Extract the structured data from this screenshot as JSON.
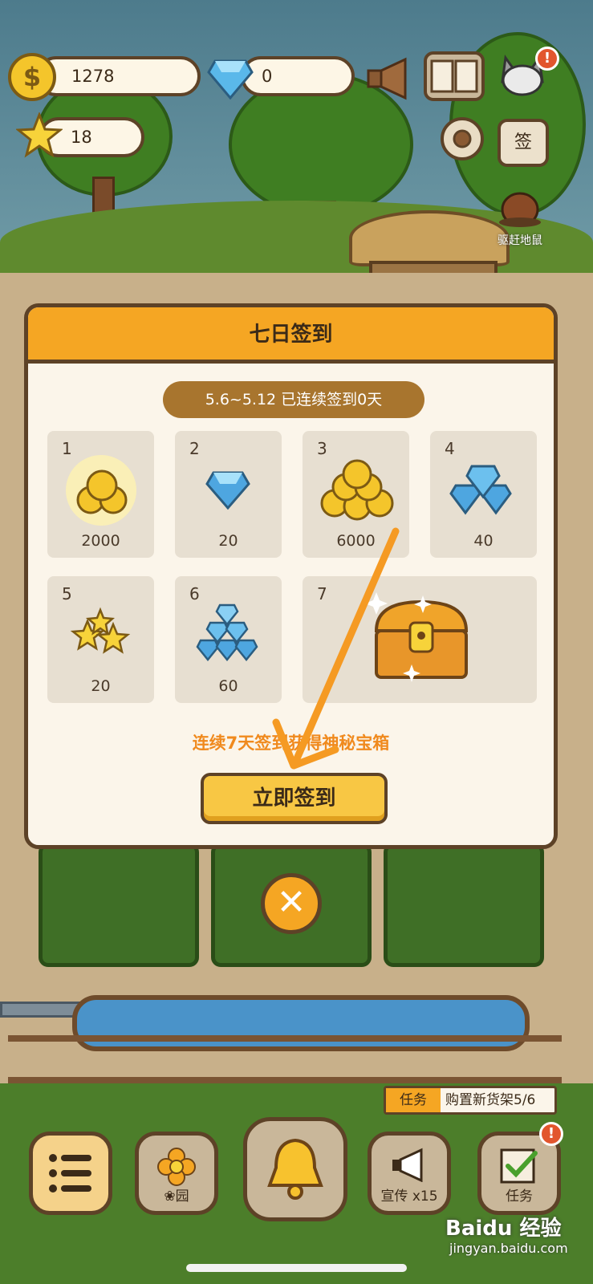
{
  "hud": {
    "coins": "1278",
    "gems": "0",
    "stars": "18",
    "coin_symbol": "$",
    "signin_badge": "签",
    "mole_label": "驱赶地鼠",
    "alert": "!"
  },
  "modal": {
    "title": "七日签到",
    "date_range": "5.6~5.12 已连续签到0天",
    "days": [
      {
        "num": "1",
        "value": "2000",
        "reward": "coin-icon"
      },
      {
        "num": "2",
        "value": "20",
        "reward": "gem-icon"
      },
      {
        "num": "3",
        "value": "6000",
        "reward": "coin-pile-icon"
      },
      {
        "num": "4",
        "value": "40",
        "reward": "gem-pile-icon"
      },
      {
        "num": "5",
        "value": "20",
        "reward": "star-icon"
      },
      {
        "num": "6",
        "value": "60",
        "reward": "gem-heap-icon"
      },
      {
        "num": "7",
        "value": "",
        "reward": "treasure-chest-icon"
      }
    ],
    "footer": "连续7天签到获得神秘宝箱",
    "signin_button": "立即签到",
    "close": "✕"
  },
  "bottom": {
    "task_tag": "任务",
    "task_text": "购置新货架5/6",
    "nav": [
      {
        "label": "",
        "icon": "list-icon"
      },
      {
        "label": "❀园",
        "icon": "flower-icon"
      },
      {
        "label": "",
        "icon": "bell-icon"
      },
      {
        "label": "宣传 x15",
        "icon": "megaphone-icon"
      },
      {
        "label": "任务",
        "icon": "checklist-icon"
      }
    ]
  },
  "watermark": {
    "brand": "Baidu 经验",
    "url": "jingyan.baidu.com"
  },
  "colors": {
    "accent": "#f5a623",
    "outline": "#5d4227",
    "panel": "#fbf5ea",
    "arrow": "#f59a23"
  }
}
